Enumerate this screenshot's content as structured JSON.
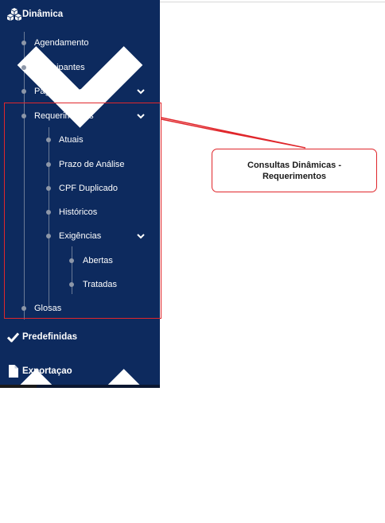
{
  "menu": {
    "dinamica": {
      "label": "Dinâmica",
      "icon": "cubes-icon"
    },
    "sub": {
      "agendamento": "Agendamento",
      "participantes": "Participantes",
      "pagamentos": "Pagamentos",
      "requerimentos": "Requerimentos",
      "glosas": "Glosas"
    },
    "req": {
      "atuais": "Atuais",
      "prazo": "Prazo de Análise",
      "cpf": "CPF Duplicado",
      "historicos": "Históricos",
      "exigencias": "Exigências"
    },
    "exig": {
      "abertas": "Abertas",
      "tratadas": "Tratadas"
    },
    "predefinidas": {
      "label": "Predefinidas",
      "icon": "check-icon"
    },
    "exportacao": {
      "label": "Exportaçao",
      "icon": "file-icon"
    }
  },
  "callout": {
    "text": "Consultas Dinâmicas -\nRequerimentos"
  },
  "colors": {
    "sidebar": "#0d2a5e",
    "highlight": "#e0262b",
    "text": "#ffffff"
  }
}
